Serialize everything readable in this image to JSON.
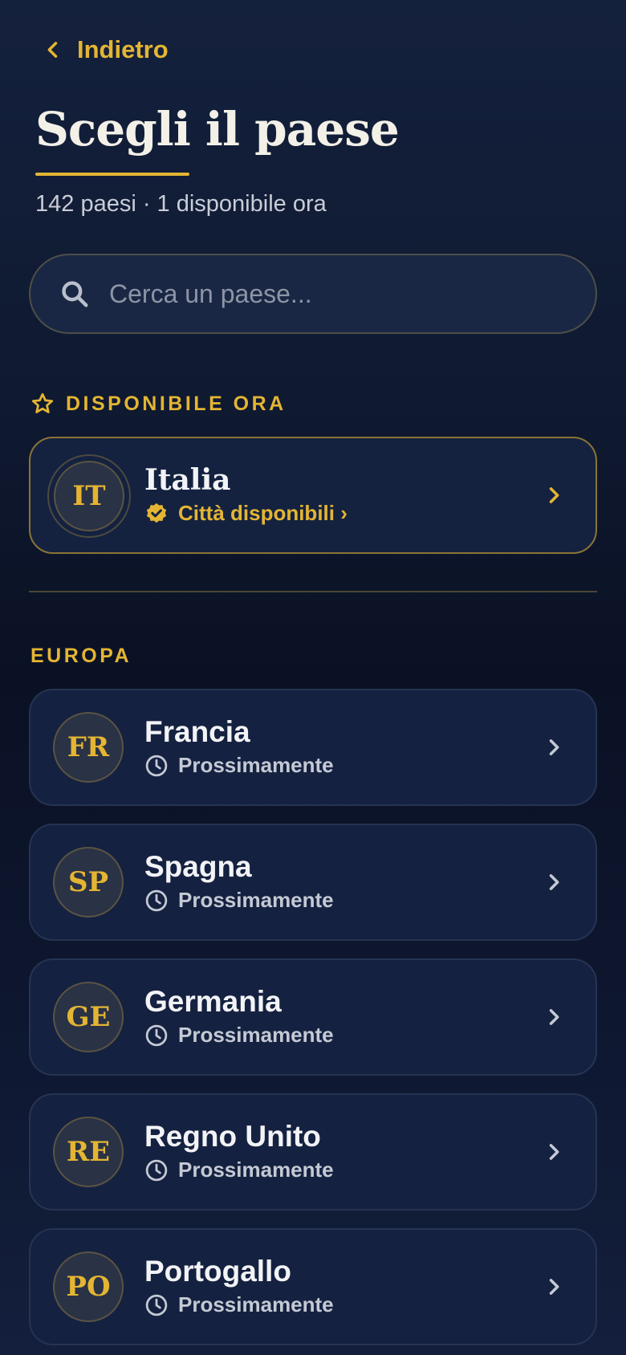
{
  "header": {
    "back_label": "Indietro",
    "title": "Scegli il paese",
    "subtitle": "142 paesi · 1 disponibile ora"
  },
  "search": {
    "placeholder": "Cerca un paese..."
  },
  "featured_section": {
    "heading": "DISPONIBILE ORA",
    "items": [
      {
        "code": "IT",
        "name": "Italia",
        "status": "Città disponibili ›"
      }
    ]
  },
  "europe_section": {
    "heading": "EUROPA",
    "items": [
      {
        "code": "FR",
        "name": "Francia",
        "status": "Prossimamente"
      },
      {
        "code": "SP",
        "name": "Spagna",
        "status": "Prossimamente"
      },
      {
        "code": "GE",
        "name": "Germania",
        "status": "Prossimamente"
      },
      {
        "code": "RE",
        "name": "Regno Unito",
        "status": "Prossimamente"
      },
      {
        "code": "PO",
        "name": "Portogallo",
        "status": "Prossimamente"
      }
    ]
  },
  "colors": {
    "accent": "#e4b533",
    "background": "#0f1930",
    "card": "#152140",
    "text": "#f2f3f6",
    "muted": "#c4c9d4"
  },
  "icons": {
    "back": "chevron-left-icon",
    "search": "search-icon",
    "section": "star-icon",
    "verified": "verified-badge-icon",
    "coming_soon": "clock-icon",
    "row": "chevron-right-icon"
  }
}
